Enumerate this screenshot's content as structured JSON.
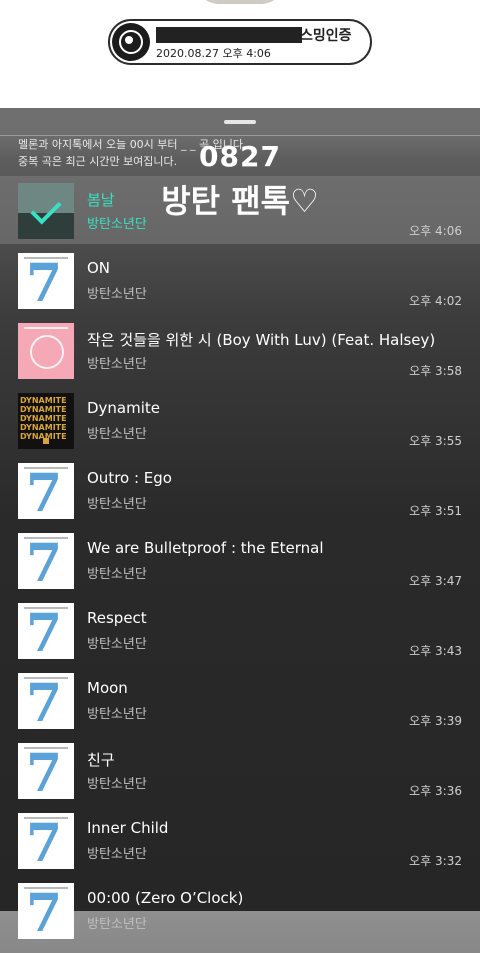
{
  "header": {
    "title_suffix": "스밍인증",
    "datetime": "2020.08.27 오후 4:06"
  },
  "notice": {
    "line1": "멜론과 아지톡에서 오늘 00시 부터 _ _ 곡 입니다.",
    "line2": "중복 곡은 최근 시간만 보여집니다."
  },
  "overlay": {
    "line1": "0827",
    "line2": "방탄 팬톡♡"
  },
  "tracks": [
    {
      "title": "봄날",
      "artist": "방탄소년단",
      "time": "오후 4:06",
      "art": "spring-day-art"
    },
    {
      "title": "ON",
      "artist": "방탄소년단",
      "time": "오후 4:02",
      "art": "map-of-the-soul-7-art"
    },
    {
      "title": "작은 것들을 위한 시 (Boy With Luv) (Feat. Halsey)",
      "artist": "방탄소년단",
      "time": "오후 3:58",
      "art": "persona-art"
    },
    {
      "title": "Dynamite",
      "artist": "방탄소년단",
      "time": "오후 3:55",
      "art": "dynamite-art"
    },
    {
      "title": "Outro : Ego",
      "artist": "방탄소년단",
      "time": "오후 3:51",
      "art": "map-of-the-soul-7-art"
    },
    {
      "title": "We are Bulletproof : the Eternal",
      "artist": "방탄소년단",
      "time": "오후 3:47",
      "art": "map-of-the-soul-7-art"
    },
    {
      "title": "Respect",
      "artist": "방탄소년단",
      "time": "오후 3:43",
      "art": "map-of-the-soul-7-art"
    },
    {
      "title": "Moon",
      "artist": "방탄소년단",
      "time": "오후 3:39",
      "art": "map-of-the-soul-7-art"
    },
    {
      "title": "친구",
      "artist": "방탄소년단",
      "time": "오후 3:36",
      "art": "map-of-the-soul-7-art"
    },
    {
      "title": "Inner Child",
      "artist": "방탄소년단",
      "time": "오후 3:32",
      "art": "map-of-the-soul-7-art"
    },
    {
      "title": "00:00 (Zero O’Clock)",
      "artist": "방탄소년단",
      "time": "",
      "art": "map-of-the-soul-7-art"
    }
  ],
  "colors": {
    "accent": "#38e0c2",
    "text_secondary": "#bfbfbf"
  }
}
